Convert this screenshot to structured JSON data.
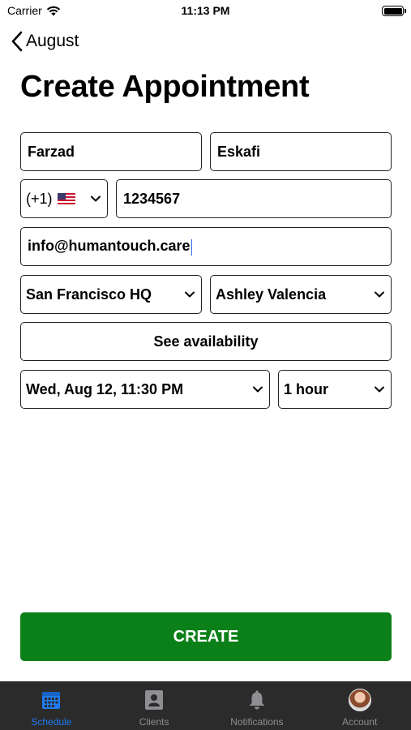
{
  "status_bar": {
    "carrier": "Carrier",
    "time": "11:13 PM"
  },
  "nav": {
    "back_label": "August"
  },
  "title": "Create Appointment",
  "form": {
    "first_name": "Farzad",
    "last_name": "Eskafi",
    "country_code": "(+1)",
    "phone": "1234567",
    "email": "info@humantouch.care",
    "location": "San Francisco HQ",
    "provider": "Ashley Valencia",
    "availability_button": "See availability",
    "datetime": "Wed, Aug 12, 11:30 PM",
    "duration": "1 hour"
  },
  "create_button": "CREATE",
  "tabs": [
    {
      "label": "Schedule",
      "icon": "calendar-icon",
      "active": true
    },
    {
      "label": "Clients",
      "icon": "contact-icon",
      "active": false
    },
    {
      "label": "Notifications",
      "icon": "bell-icon",
      "active": false
    },
    {
      "label": "Account",
      "icon": "avatar",
      "active": false
    }
  ],
  "colors": {
    "accent": "#0b8019",
    "tab_active": "#1e7cf2",
    "tab_bar": "#2b2b2b"
  }
}
